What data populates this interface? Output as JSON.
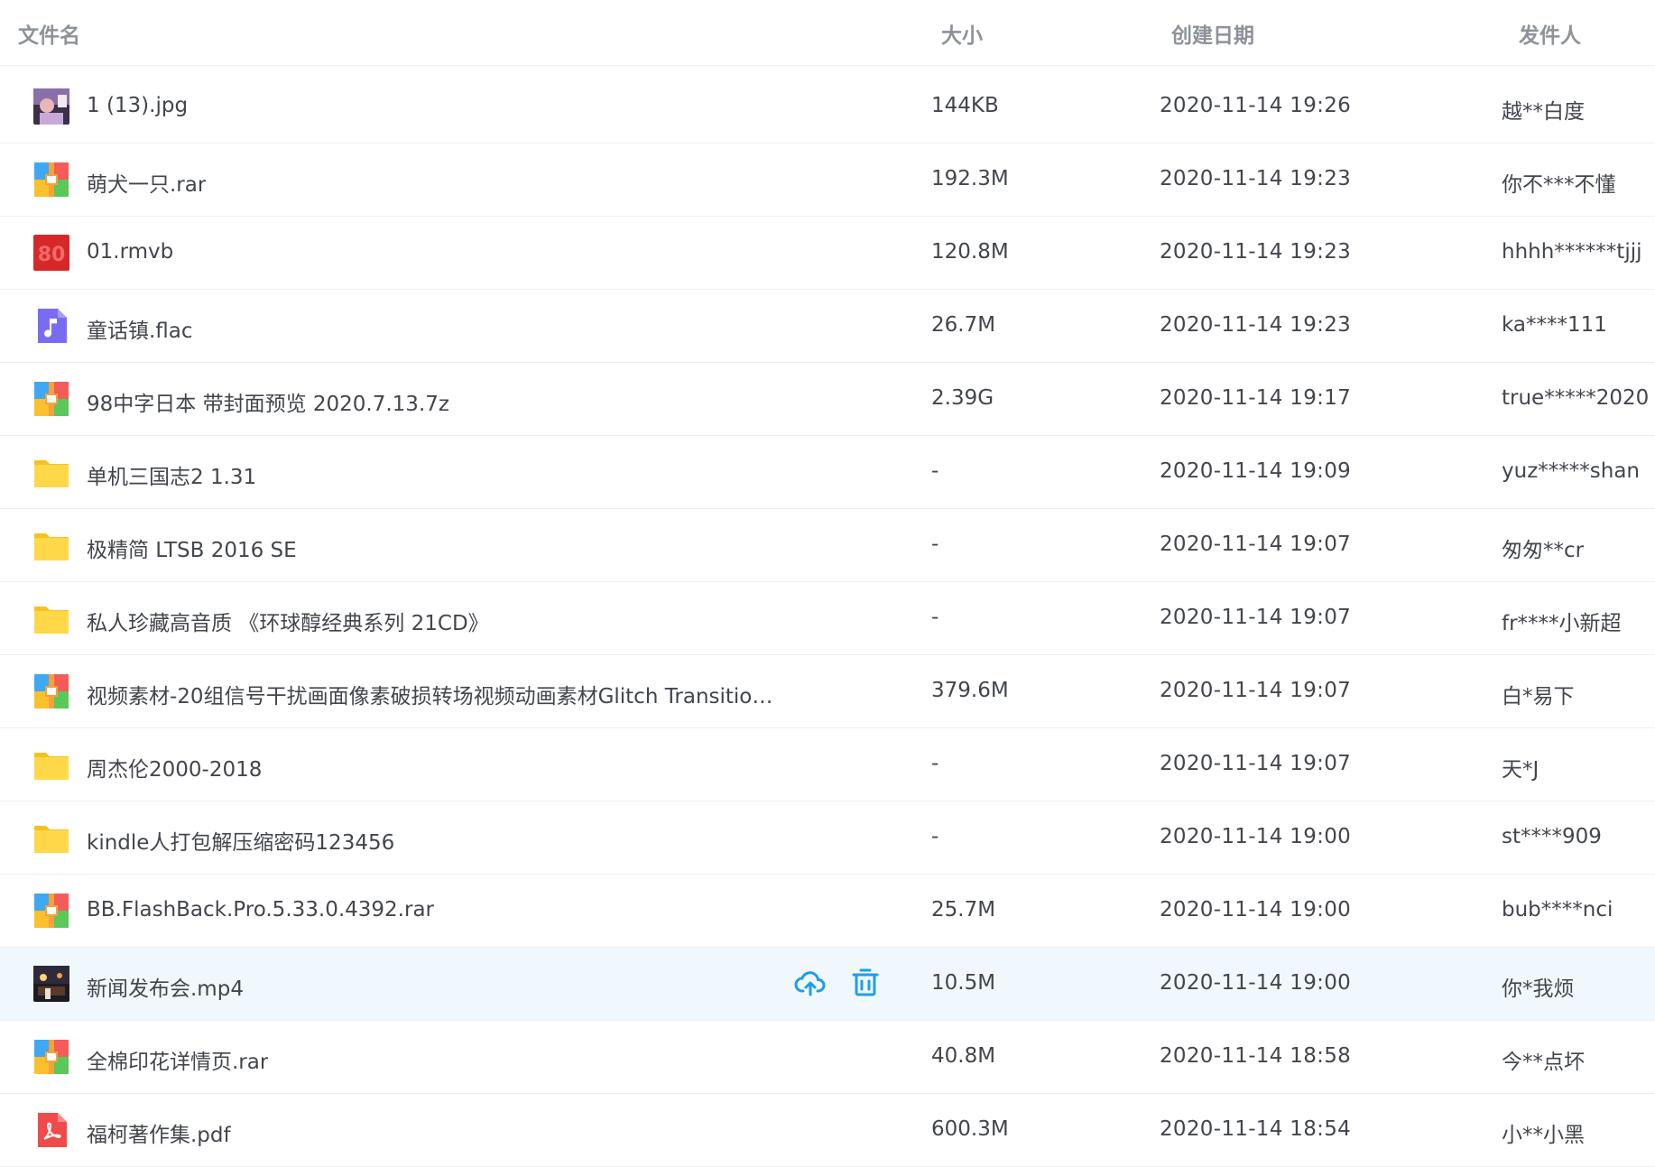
{
  "header": {
    "name": "文件名",
    "size": "大小",
    "date": "创建日期",
    "sender": "发件人"
  },
  "rows": [
    {
      "name": "1 (13).jpg",
      "size": "144KB",
      "date": "2020-11-14 19:26",
      "sender": "越**白度",
      "icon": "image-thumbnail-icon"
    },
    {
      "name": "萌犬一只.rar",
      "size": "192.3M",
      "date": "2020-11-14 19:23",
      "sender": "你不***不懂",
      "icon": "archive-icon"
    },
    {
      "name": "01.rmvb",
      "size": "120.8M",
      "date": "2020-11-14 19:23",
      "sender": "hhhh******tjjj",
      "icon": "video-thumbnail-icon"
    },
    {
      "name": "童话镇.flac",
      "size": "26.7M",
      "date": "2020-11-14 19:23",
      "sender": "ka****111",
      "icon": "audio-file-icon"
    },
    {
      "name": "98中字日本 带封面预览 2020.7.13.7z",
      "size": "2.39G",
      "date": "2020-11-14 19:17",
      "sender": "true*****2020",
      "icon": "archive-icon"
    },
    {
      "name": "单机三国志2 1.31",
      "size": "-",
      "date": "2020-11-14 19:09",
      "sender": "yuz*****shan",
      "icon": "folder-icon"
    },
    {
      "name": "极精简 LTSB 2016 SE",
      "size": "-",
      "date": "2020-11-14 19:07",
      "sender": "匆匆**cr",
      "icon": "folder-icon"
    },
    {
      "name": "私人珍藏高音质 《环球醇经典系列 21CD》",
      "size": "-",
      "date": "2020-11-14 19:07",
      "sender": "fr****小新超",
      "icon": "folder-icon"
    },
    {
      "name": "视频素材-20组信号干扰画面像素破损转场视频动画素材Glitch Transition...",
      "size": "379.6M",
      "date": "2020-11-14 19:07",
      "sender": "白*易下",
      "icon": "archive-icon"
    },
    {
      "name": "周杰伦2000-2018",
      "size": "-",
      "date": "2020-11-14 19:07",
      "sender": "天*J",
      "icon": "folder-icon"
    },
    {
      "name": "kindle人打包解压缩密码123456",
      "size": "-",
      "date": "2020-11-14 19:00",
      "sender": "st****909",
      "icon": "folder-icon"
    },
    {
      "name": "BB.FlashBack.Pro.5.33.0.4392.rar",
      "size": "25.7M",
      "date": "2020-11-14 19:00",
      "sender": "bub****nci",
      "icon": "archive-icon"
    },
    {
      "name": "新闻发布会.mp4",
      "size": "10.5M",
      "date": "2020-11-14 19:00",
      "sender": "你*我烦",
      "icon": "video-thumbnail-icon",
      "hover": true
    },
    {
      "name": "全棉印花详情页.rar",
      "size": "40.8M",
      "date": "2020-11-14 18:58",
      "sender": "今**点坏",
      "icon": "archive-icon"
    },
    {
      "name": "福柯著作集.pdf",
      "size": "600.3M",
      "date": "2020-11-14 18:54",
      "sender": "小**小黑",
      "icon": "pdf-file-icon"
    }
  ],
  "colors": {
    "accent": "#1f9ee8",
    "folder": "#ffd23f",
    "hover_row": "#f1f8fd",
    "pdf": "#ef4b4b",
    "audio": "#7a6cf2"
  }
}
